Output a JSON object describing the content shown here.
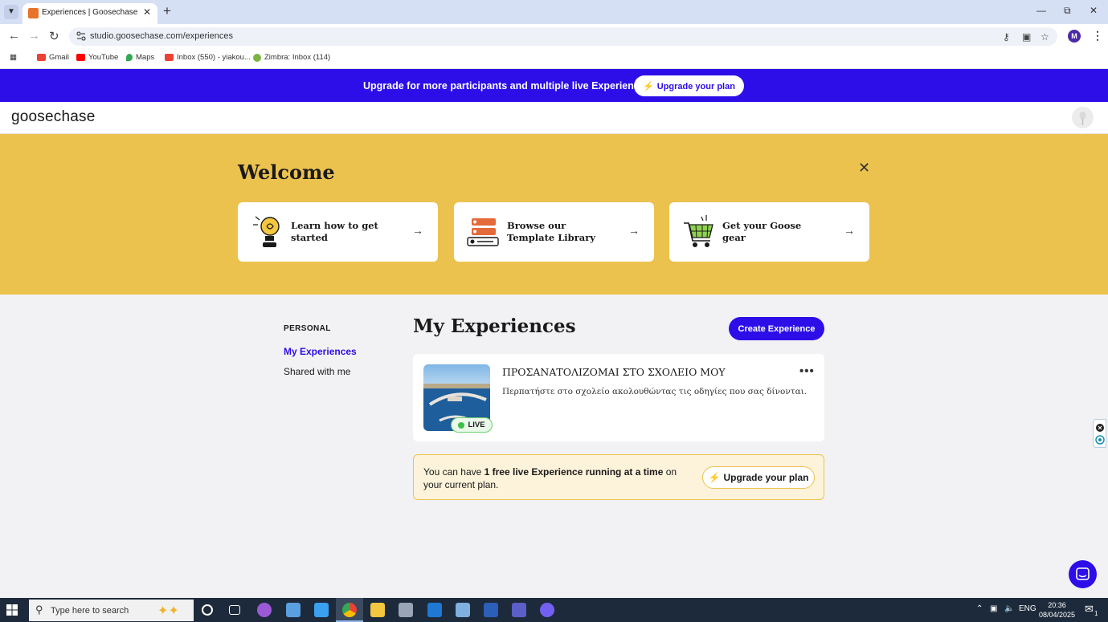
{
  "browser": {
    "tab_title": "Experiences | Goosechase",
    "url": "studio.goosechase.com/experiences",
    "profile_initial": "M",
    "bookmarks": [
      {
        "label": "Gmail",
        "color": "#ea4335"
      },
      {
        "label": "YouTube",
        "color": "#ff0000"
      },
      {
        "label": "Maps",
        "color": "#34a853"
      },
      {
        "label": "Inbox (550) - yiakou...",
        "color": "#ea4335"
      },
      {
        "label": "Zimbra: Inbox (114)",
        "color": "#7cb342"
      }
    ]
  },
  "promo": {
    "text": "Upgrade for more participants and multiple live Experiences",
    "button": "Upgrade your plan"
  },
  "app": {
    "logo": "goosechase"
  },
  "welcome": {
    "title": "Welcome",
    "cards": [
      {
        "label": "Learn how to get started",
        "icon": "lightbulb-icon"
      },
      {
        "label": "Browse our Template Library",
        "icon": "template-library-icon"
      },
      {
        "label": "Get your Goose gear",
        "icon": "shopping-cart-icon"
      }
    ]
  },
  "sidebar": {
    "heading": "PERSONAL",
    "items": [
      {
        "label": "My Experiences",
        "active": true
      },
      {
        "label": "Shared with me",
        "active": false
      }
    ]
  },
  "main": {
    "title": "My Experiences",
    "create_button": "Create Experience",
    "experiences": [
      {
        "name": "ΠΡΟΣΑΝΑΤΟΛΙΖΟΜΑΙ ΣΤΟ ΣΧΟΛΕΙΟ ΜΟΥ",
        "description": "Περπατήστε στο σχολείο ακολουθώντας τις οδηγίες που σας δίνονται.",
        "status": "LIVE"
      }
    ],
    "notice": {
      "text_before": "You can have ",
      "text_bold": "1 free live Experience running at a time",
      "text_after": " on your current plan.",
      "button": "Upgrade your plan"
    }
  },
  "taskbar": {
    "search_placeholder": "Type here to search",
    "language": "ENG",
    "time": "20:36",
    "date": "08/04/2025",
    "notification_count": "1"
  },
  "colors": {
    "brand": "#2d0ee8",
    "welcome_bg": "#ecc24f",
    "live_green": "#3fbf4a"
  }
}
